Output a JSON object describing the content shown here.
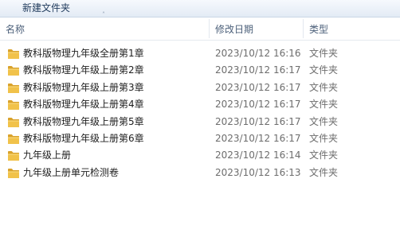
{
  "toolbar": {
    "new_folder_label": "新建文件夹"
  },
  "columns": {
    "name": "名称",
    "date": "修改日期",
    "type": "类型",
    "sort_indicator": "˄"
  },
  "colors": {
    "folder_yellow": "#f1c24a",
    "folder_dark": "#d9a22b",
    "header_text": "#4c607a"
  },
  "files": [
    {
      "name": "教科版物理九年级全册第1章",
      "date": "2023/10/12 16:16",
      "type": "文件夹",
      "icon": "folder-icon"
    },
    {
      "name": "教科版物理九年级上册第2章",
      "date": "2023/10/12 16:17",
      "type": "文件夹",
      "icon": "folder-icon"
    },
    {
      "name": "教科版物理九年级上册第3章",
      "date": "2023/10/12 16:17",
      "type": "文件夹",
      "icon": "folder-icon"
    },
    {
      "name": "教科版物理九年级上册第4章",
      "date": "2023/10/12 16:17",
      "type": "文件夹",
      "icon": "folder-icon"
    },
    {
      "name": "教科版物理九年级上册第5章",
      "date": "2023/10/12 16:17",
      "type": "文件夹",
      "icon": "folder-icon"
    },
    {
      "name": "教科版物理九年级上册第6章",
      "date": "2023/10/12 16:17",
      "type": "文件夹",
      "icon": "folder-icon"
    },
    {
      "name": "九年级上册",
      "date": "2023/10/12 16:14",
      "type": "文件夹",
      "icon": "folder-icon"
    },
    {
      "name": "九年级上册单元检测卷",
      "date": "2023/10/12 16:13",
      "type": "文件夹",
      "icon": "folder-icon"
    }
  ]
}
